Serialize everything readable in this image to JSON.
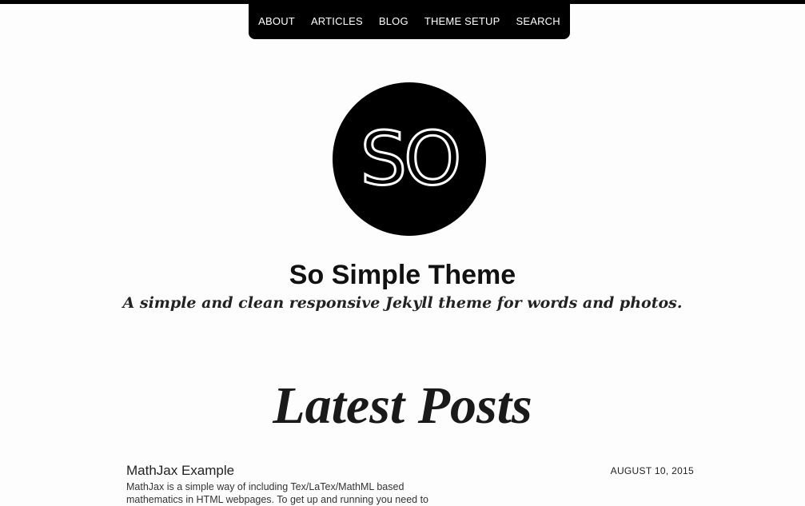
{
  "nav": {
    "items": [
      {
        "label": "ABOUT"
      },
      {
        "label": "ARTICLES"
      },
      {
        "label": "BLOG"
      },
      {
        "label": "THEME SETUP"
      },
      {
        "label": "SEARCH"
      }
    ]
  },
  "logo": {
    "text": "SO"
  },
  "site": {
    "title": "So Simple Theme",
    "tagline": "A simple and clean responsive Jekyll theme for words and photos."
  },
  "latest_posts": {
    "heading": "Latest Posts",
    "posts": [
      {
        "title": "MathJax Example",
        "date": "AUGUST 10, 2015",
        "excerpt": "MathJax is a simple way of including Tex/LaTex/MathML based mathematics in HTML webpages. To get up and running you need to"
      }
    ]
  },
  "colors": {
    "background": "#fdfdfd",
    "nav_background": "#000000",
    "nav_text": "#ffffff",
    "logo_background": "#000000"
  }
}
